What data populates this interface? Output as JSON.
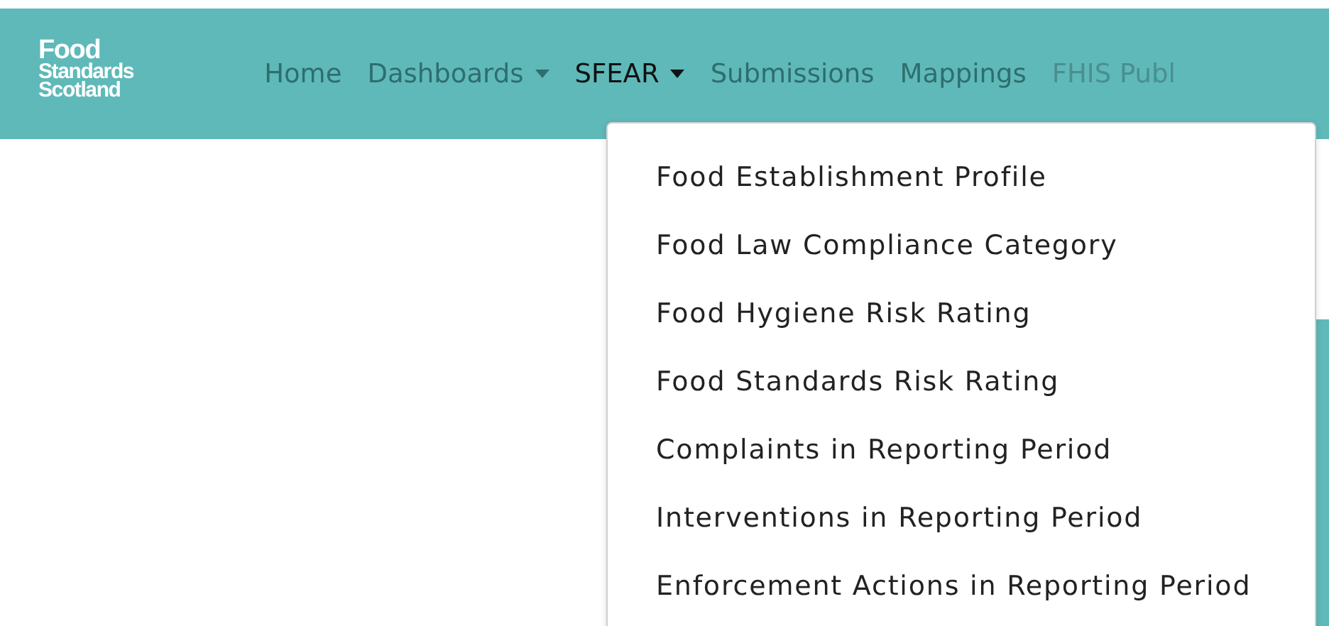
{
  "logo": {
    "lines": [
      "Food",
      "Standards",
      "Scotland"
    ]
  },
  "nav": [
    {
      "label": "Home",
      "kind": "link",
      "selected": false,
      "disabled": false
    },
    {
      "label": "Dashboards",
      "kind": "dropdown",
      "selected": false,
      "disabled": false
    },
    {
      "label": "SFEAR",
      "kind": "dropdown",
      "selected": true,
      "disabled": false
    },
    {
      "label": "Submissions",
      "kind": "link",
      "selected": false,
      "disabled": false
    },
    {
      "label": "Mappings",
      "kind": "link",
      "selected": false,
      "disabled": false
    },
    {
      "label": "FHIS Publ",
      "kind": "link",
      "selected": false,
      "disabled": true
    }
  ],
  "dropdown": {
    "items": [
      "Food Establishment Profile",
      "Food Law Compliance Category",
      "Food Hygiene Risk Rating",
      "Food Standards Risk Rating",
      "Complaints in Reporting Period",
      "Interventions in Reporting Period",
      "Enforcement Actions in Reporting Period"
    ]
  }
}
